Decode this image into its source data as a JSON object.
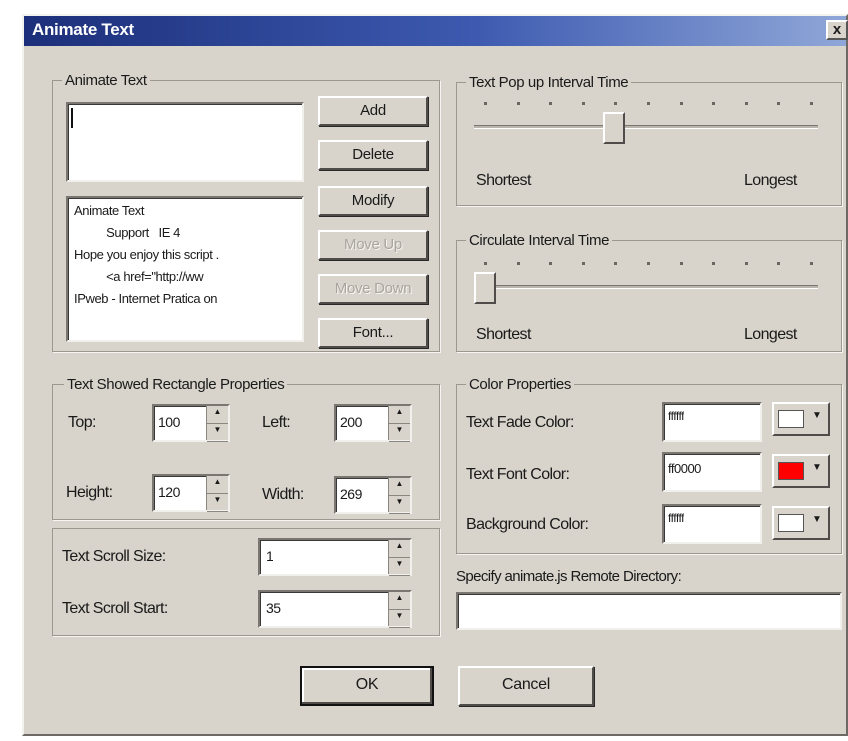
{
  "window": {
    "title": "Animate Text",
    "close_glyph": "x"
  },
  "animate_text": {
    "legend": "Animate Text",
    "input_value": "",
    "buttons": {
      "add": "Add",
      "delete": "Delete",
      "modify": "Modify",
      "move_up": "Move Up",
      "move_down": "Move Down",
      "font": "Font..."
    },
    "list": [
      "Animate   Text",
      "          Support   IE 4",
      "Hope you enjoy this script .",
      "          <a href=\"http://ww",
      "IPweb - Internet Pratica on"
    ]
  },
  "popup_interval": {
    "legend": "Text Pop up Interval Time",
    "min_label": "Shortest",
    "max_label": "Longest",
    "ticks": 11,
    "position": 0.4
  },
  "circulate_interval": {
    "legend": "Circulate Interval Time",
    "min_label": "Shortest",
    "max_label": "Longest",
    "ticks": 11,
    "position": 0
  },
  "rect_props": {
    "legend": "Text Showed Rectangle Properties",
    "top_label": "Top:",
    "top_value": "100",
    "left_label": "Left:",
    "left_value": "200",
    "height_label": "Height:",
    "height_value": "120",
    "width_label": "Width:",
    "width_value": "269"
  },
  "scroll": {
    "size_label": "Text Scroll Size:",
    "size_value": "1",
    "start_label": "Text Scroll Start:",
    "start_value": "35"
  },
  "color_props": {
    "legend": "Color Properties",
    "fade_label": "Text Fade Color:",
    "fade_value": "ffffff",
    "fade_color": "#ffffff",
    "font_label": "Text Font Color:",
    "font_value": "ff0000",
    "font_color": "#ff0000",
    "bg_label": "Background Color:",
    "bg_value": "ffffff",
    "bg_color": "#ffffff"
  },
  "remote_dir": {
    "label": "Specify animate.js Remote Directory:",
    "value": ""
  },
  "footer": {
    "ok": "OK",
    "cancel": "Cancel"
  }
}
